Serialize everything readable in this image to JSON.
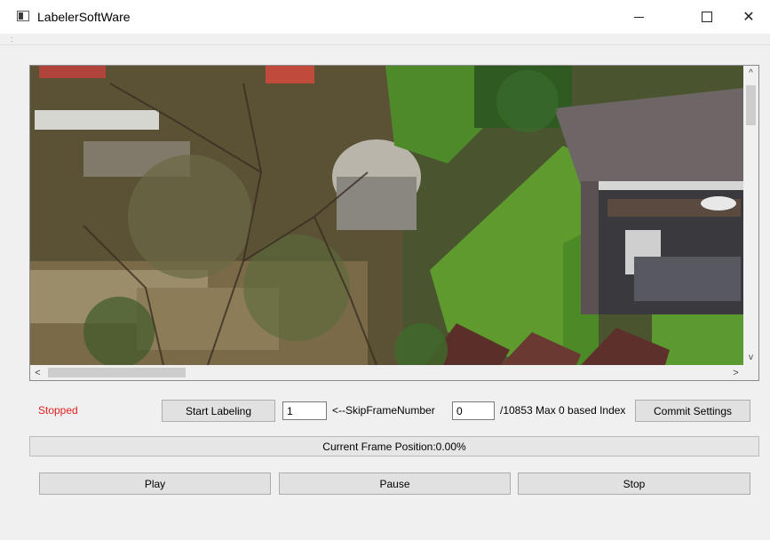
{
  "window": {
    "title": "LabelerSoftWare",
    "minimize_glyph": "—",
    "close_glyph": "✕"
  },
  "viewer": {
    "scroll_up": "^",
    "scroll_down": "v",
    "scroll_left": "<",
    "scroll_right": ">"
  },
  "controls": {
    "status_text": "Stopped",
    "status_color": "#e02020",
    "start_labeling_label": "Start Labeling",
    "skip_frame_value": "1",
    "skip_frame_label": "<--SkipFrameNumber",
    "frame_index_value": "0",
    "frame_index_label": "/10853 Max 0 based Index",
    "commit_settings_label": "Commit Settings"
  },
  "progress": {
    "text": "Current Frame Position:0.00%",
    "value_percent": 0
  },
  "playback": {
    "play_label": "Play",
    "pause_label": "Pause",
    "stop_label": "Stop"
  }
}
